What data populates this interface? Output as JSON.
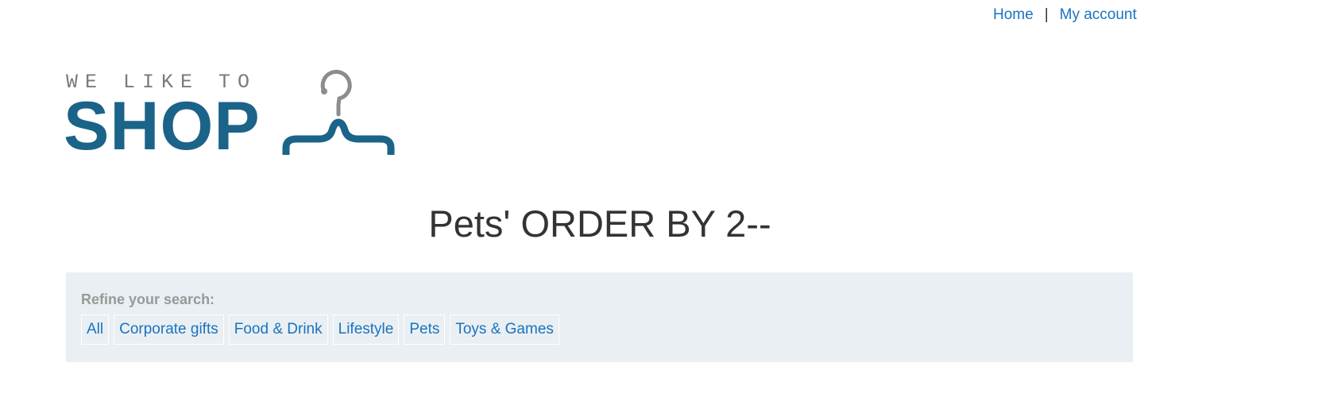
{
  "nav": {
    "home": "Home",
    "separator": "|",
    "account": "My account"
  },
  "logo": {
    "tagline": "WE LIKE TO",
    "word": "SHOP",
    "icon": "hanger-icon"
  },
  "heading": "Pets' ORDER BY 2--",
  "refine": {
    "label": "Refine your search:",
    "filters": [
      "All",
      "Corporate gifts",
      "Food & Drink",
      "Lifestyle",
      "Pets",
      "Toys & Games"
    ]
  },
  "colors": {
    "link": "#1a73c1",
    "brand": "#1b6388",
    "panel": "#e9eff2"
  }
}
